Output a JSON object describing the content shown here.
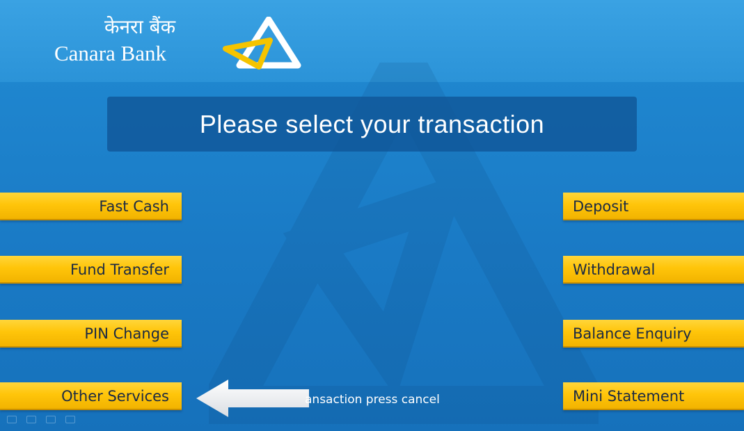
{
  "logo": {
    "hindi": "केनरा बैंक",
    "english": "Canara Bank"
  },
  "title": "Please select your transaction",
  "options_left": [
    {
      "label": "Fast Cash"
    },
    {
      "label": "Fund Transfer"
    },
    {
      "label": "PIN Change"
    },
    {
      "label": "Other Services"
    }
  ],
  "options_right": [
    {
      "label": "Deposit"
    },
    {
      "label": "Withdrawal"
    },
    {
      "label": "Balance Enquiry"
    },
    {
      "label": "Mini Statement"
    }
  ],
  "cancel_hint": "ansaction press cancel",
  "colors": {
    "background": "#1a7bc6",
    "button": "#ffc50a",
    "button_text": "#1b2a44",
    "title_box": "#105496"
  },
  "icons": [
    "canara-triangle-logo-icon",
    "left-arrow-icon"
  ]
}
